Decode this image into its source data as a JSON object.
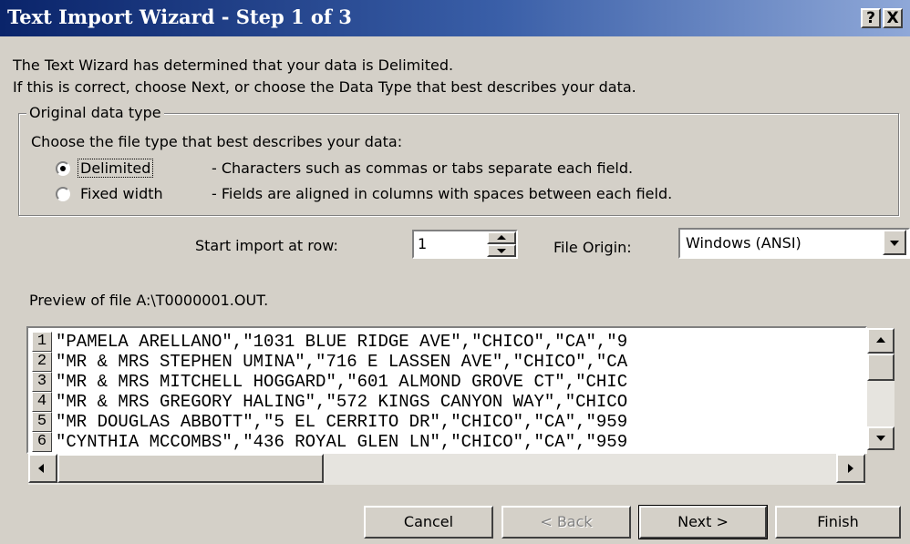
{
  "window": {
    "title": "Text Import Wizard - Step 1 of 3"
  },
  "titlebar_buttons": {
    "help": "?",
    "close": "X"
  },
  "intro": {
    "line1": "The Text Wizard has determined that your data is Delimited.",
    "line2": "If this is correct, choose Next, or choose the Data Type that best describes your data."
  },
  "original_data_type": {
    "legend": "Original data type",
    "prompt": "Choose the file type that best describes your data:",
    "options": [
      {
        "label": "Delimited",
        "selected": true,
        "description": "- Characters such as commas or tabs separate each field."
      },
      {
        "label": "Fixed width",
        "selected": false,
        "description": "- Fields are aligned in columns with spaces between each field."
      }
    ]
  },
  "start_row": {
    "label": "Start import at row:",
    "value": "1"
  },
  "file_origin": {
    "label": "File Origin:",
    "value": "Windows (ANSI)"
  },
  "preview": {
    "label": "Preview of file A:\\T0000001.OUT.",
    "rows": [
      {
        "num": "1",
        "text": "\"PAMELA ARELLANO\",\"1031 BLUE RIDGE AVE\",\"CHICO\",\"CA\",\"9"
      },
      {
        "num": "2",
        "text": "\"MR & MRS STEPHEN UMINA\",\"716 E LASSEN AVE\",\"CHICO\",\"CA"
      },
      {
        "num": "3",
        "text": "\"MR & MRS MITCHELL HOGGARD\",\"601 ALMOND GROVE CT\",\"CHIC"
      },
      {
        "num": "4",
        "text": "\"MR & MRS GREGORY HALING\",\"572 KINGS CANYON WAY\",\"CHICO"
      },
      {
        "num": "5",
        "text": "\"MR DOUGLAS ABBOTT\",\"5 EL CERRITO DR\",\"CHICO\",\"CA\",\"959"
      },
      {
        "num": "6",
        "text": "\"CYNTHIA MCCOMBS\",\"436 ROYAL GLEN LN\",\"CHICO\",\"CA\",\"959"
      }
    ]
  },
  "buttons": {
    "cancel": "Cancel",
    "back": "< Back",
    "next": "Next >",
    "finish": "Finish"
  },
  "colors": {
    "titlebar_start": "#0a246a",
    "titlebar_end": "#8fa8d8",
    "face": "#d4d0c8"
  }
}
